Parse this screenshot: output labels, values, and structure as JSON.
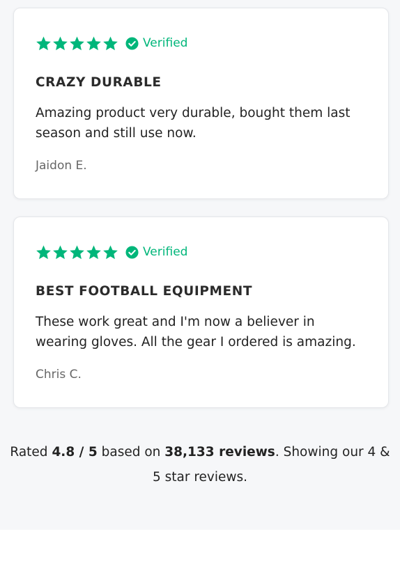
{
  "reviews": [
    {
      "stars": 5,
      "verified_label": "Verified",
      "title": "CRAZY DURABLE",
      "body": "Amazing product very durable, bought them last season and still use now.",
      "author": "Jaidon E."
    },
    {
      "stars": 5,
      "verified_label": "Verified",
      "title": "BEST FOOTBALL EQUIPMENT",
      "body": "These work great and I'm now a believer in wearing gloves. All the gear I ordered is amazing.",
      "author": "Chris C."
    }
  ],
  "summary": {
    "prefix": "Rated ",
    "rating": "4.8 / 5",
    "middle": " based on ",
    "count": "38,133 reviews",
    "suffix": ". Showing our 4 & 5 star reviews."
  },
  "colors": {
    "star": "#00b67a",
    "verified": "#00b67a"
  },
  "icons": {
    "star": "star-icon",
    "verified": "check-circle-icon"
  }
}
